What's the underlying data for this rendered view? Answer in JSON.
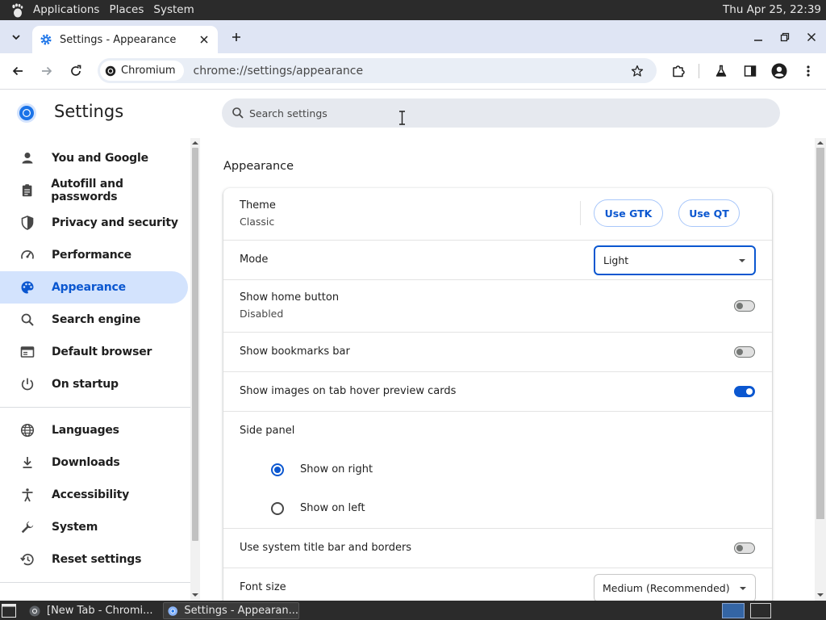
{
  "top_panel": {
    "menus": [
      "Applications",
      "Places",
      "System"
    ],
    "clock": "Thu Apr 25, 22:39"
  },
  "browser": {
    "active_tab_title": "Settings - Appearance",
    "site_chip": "Chromium",
    "url": "chrome://settings/appearance"
  },
  "settings": {
    "title": "Settings",
    "search_placeholder": "Search settings",
    "sidebar": [
      {
        "label": "You and Google",
        "icon": "person-icon"
      },
      {
        "label": "Autofill and passwords",
        "icon": "clipboard-icon"
      },
      {
        "label": "Privacy and security",
        "icon": "shield-icon"
      },
      {
        "label": "Performance",
        "icon": "speedometer-icon"
      },
      {
        "label": "Appearance",
        "icon": "palette-icon",
        "selected": true
      },
      {
        "label": "Search engine",
        "icon": "search-icon"
      },
      {
        "label": "Default browser",
        "icon": "browser-window-icon"
      },
      {
        "label": "On startup",
        "icon": "power-icon"
      },
      {
        "label": "Languages",
        "icon": "globe-icon"
      },
      {
        "label": "Downloads",
        "icon": "download-icon"
      },
      {
        "label": "Accessibility",
        "icon": "accessibility-icon"
      },
      {
        "label": "System",
        "icon": "wrench-icon"
      },
      {
        "label": "Reset settings",
        "icon": "history-icon"
      }
    ],
    "section_title": "Appearance",
    "theme": {
      "label": "Theme",
      "value": "Classic",
      "btn_gtk": "Use GTK",
      "btn_qt": "Use QT"
    },
    "mode": {
      "label": "Mode",
      "value": "Light"
    },
    "home_button": {
      "label": "Show home button",
      "sub": "Disabled",
      "on": false
    },
    "bookmarks_bar": {
      "label": "Show bookmarks bar",
      "on": false
    },
    "tab_hover": {
      "label": "Show images on tab hover preview cards",
      "on": true
    },
    "side_panel": {
      "label": "Side panel",
      "options": [
        "Show on right",
        "Show on left"
      ],
      "selected": "Show on right"
    },
    "title_bar": {
      "label": "Use system title bar and borders",
      "on": false
    },
    "font_size": {
      "label": "Font size",
      "value": "Medium (Recommended)"
    }
  },
  "taskbar": {
    "tasks": [
      "[New Tab - Chromi...",
      "Settings - Appearan..."
    ]
  },
  "colors": {
    "accent": "#0b57d0",
    "selected_nav_bg": "#d3e3fd",
    "panel_bg": "#2b2b2b",
    "tabstrip_bg": "#dfe5f4"
  }
}
